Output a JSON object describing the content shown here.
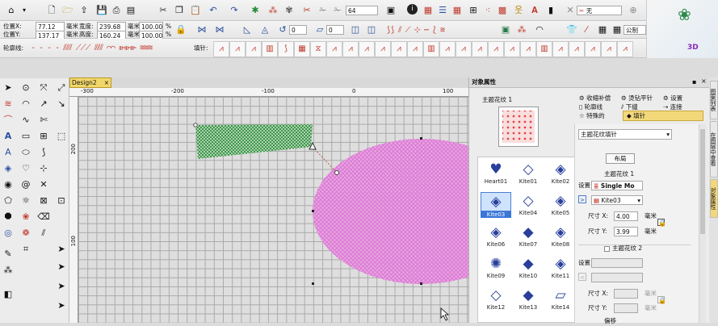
{
  "toolbar1": {
    "zoom_value": "64",
    "size_value": "无",
    "icons": [
      "home-icon",
      "new-icon",
      "open-icon",
      "export-icon",
      "save-icon",
      "print-icon",
      "properties-icon",
      "cut-icon",
      "copy-icon",
      "paste-icon",
      "undo-icon",
      "redo-icon"
    ]
  },
  "position": {
    "x_label": "位置X:",
    "x_value": "77.12",
    "y_label": "位置Y:",
    "y_value": "137.17",
    "unit": "毫米",
    "w_label": "宽度:",
    "w_value": "239.68",
    "h_label": "高度:",
    "h_value": "160.24",
    "pct_w": "100.00",
    "pct_h": "100.00",
    "pct": "%"
  },
  "rotate": {
    "angle1": "0",
    "angle2": "0"
  },
  "units": {
    "value": "公制"
  },
  "row3": {
    "outline_label": "轮廓线:",
    "fill_label": "填针:"
  },
  "document": {
    "tab_label": "Design2",
    "close_label": "×"
  },
  "ruler": {
    "h_ticks": [
      "-300",
      "-200",
      "-100",
      "0",
      "100"
    ],
    "v_ticks": [
      "200",
      "100"
    ]
  },
  "panel": {
    "title": "对象属性",
    "tabs_row1": [
      "收缩补偿",
      "烫钻平针",
      "设置"
    ],
    "tabs_row2": [
      "轮廓线",
      "下缝",
      "连接"
    ],
    "tabs_row3": [
      "特殊的",
      "填针"
    ],
    "motif_title": "主题花纹 1",
    "patterns": [
      {
        "name": "Heart01",
        "glyph": "♥",
        "selected": false
      },
      {
        "name": "Kite01",
        "glyph": "◇",
        "selected": false
      },
      {
        "name": "Kite02",
        "glyph": "◈",
        "selected": false
      },
      {
        "name": "Kite03",
        "glyph": "◈",
        "selected": true
      },
      {
        "name": "Kite04",
        "glyph": "◇",
        "selected": false
      },
      {
        "name": "Kite05",
        "glyph": "◈",
        "selected": false
      },
      {
        "name": "Kite06",
        "glyph": "◈",
        "selected": false
      },
      {
        "name": "Kite07",
        "glyph": "◆",
        "selected": false
      },
      {
        "name": "Kite08",
        "glyph": "◈",
        "selected": false
      },
      {
        "name": "Kite09",
        "glyph": "✺",
        "selected": false
      },
      {
        "name": "Kite10",
        "glyph": "◆",
        "selected": false
      },
      {
        "name": "Kite11",
        "glyph": "◈",
        "selected": false
      },
      {
        "name": "Kite12",
        "glyph": "◇",
        "selected": false
      },
      {
        "name": "Kite13",
        "glyph": "◆",
        "selected": false
      },
      {
        "name": "Kite14",
        "glyph": "▱",
        "selected": false
      }
    ],
    "fill_type": "主题花纹填针",
    "layout_btn": "布局",
    "motif1_label": "主题花纹 1",
    "setting_label": "设置",
    "setting_value": "Single Mo",
    "pattern_value": "Kite03",
    "size_x_label": "尺寸 X:",
    "size_x_value": "4.00",
    "size_y_label": "尺寸 Y:",
    "size_y_value": "3.99",
    "unit": "毫米",
    "motif2_label": "主题花纹 2",
    "setting2_label": "设置",
    "size_x2_label": "尺寸 X:",
    "size_y2_label": "尺寸 Y:",
    "bottom_label": "偏移"
  },
  "side_tabs": [
    "图案列表",
    "在图层中查看",
    "对象属性"
  ]
}
